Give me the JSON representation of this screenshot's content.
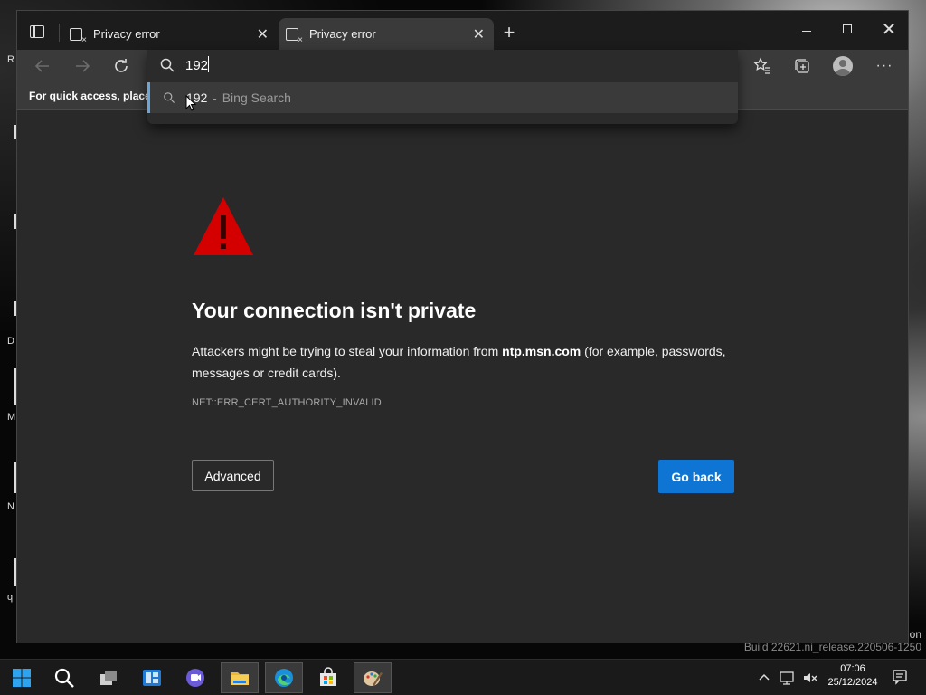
{
  "desktop": {
    "peek_letters": [
      "R",
      "D",
      "M",
      "N",
      "q"
    ],
    "watermark_line1": "on",
    "watermark_line2": "Build 22621.ni_release.220506-1250"
  },
  "browser": {
    "tabs": [
      {
        "label": "Privacy error",
        "state": "inactive"
      },
      {
        "label": "Privacy error",
        "state": "active"
      }
    ],
    "new_tab_glyph": "+",
    "favorites_bar_text": "For quick access, place y",
    "address": {
      "value": "192",
      "suggestion_query": "192",
      "suggestion_separator": "-",
      "suggestion_engine": "Bing Search"
    }
  },
  "page": {
    "title": "Your connection isn't private",
    "desc_before": "Attackers might be trying to steal your information from ",
    "desc_host": "ntp.msn.com",
    "desc_after": " (for example, passwords, messages or credit cards).",
    "error_code": "NET::ERR_CERT_AUTHORITY_INVALID",
    "advanced_label": "Advanced",
    "go_back_label": "Go back"
  },
  "taskbar": {
    "apps": [
      "start-icon",
      "search-icon",
      "task-view-icon",
      "widgets-icon",
      "chat-icon",
      "file-explorer-icon",
      "edge-icon",
      "store-icon",
      "paint-icon"
    ],
    "active_apps": [
      "file-explorer-icon",
      "edge-icon",
      "paint-icon"
    ],
    "time": "07:06",
    "date": "25/12/2024"
  },
  "colors": {
    "accent": "#0f75d4",
    "warning": "#d40000",
    "page_bg": "#292929",
    "suggestion_highlight": "#6aa7d8"
  }
}
